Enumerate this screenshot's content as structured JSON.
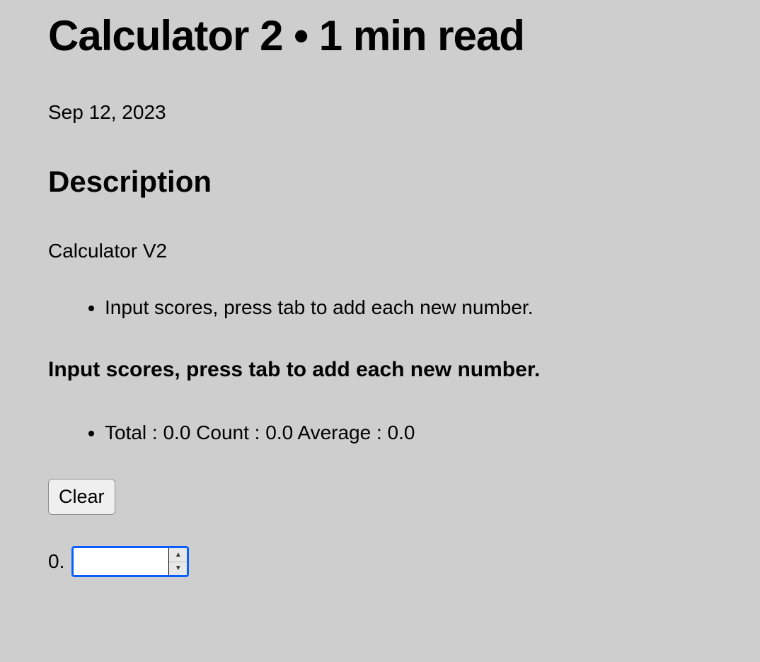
{
  "page": {
    "title": "Calculator 2 • 1 min read",
    "date": "Sep 12, 2023"
  },
  "description": {
    "heading": "Description",
    "text": "Calculator V2",
    "bullet": "Input scores, press tab to add each new number."
  },
  "instruction_heading": "Input scores, press tab to add each new number.",
  "stats": {
    "line": "Total : 0.0 Count : 0.0 Average : 0.0"
  },
  "buttons": {
    "clear": "Clear"
  },
  "input": {
    "label": "0.",
    "value": ""
  }
}
